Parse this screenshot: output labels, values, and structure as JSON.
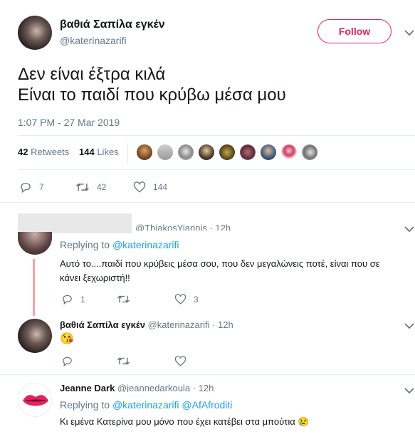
{
  "main_tweet": {
    "display_name": "βαθιά Σαπίλα εγκέν",
    "handle": "@katerinazarifi",
    "follow_label": "Follow",
    "text_line1": "Δεν είναι έξτρα κιλά",
    "text_line2": "Είναι το παιδί που κρύβω μέσα μου",
    "timestamp": "1:07 PM - 27 Mar 2019",
    "retweets_count": "42",
    "retweets_label": "Retweets",
    "likes_count": "144",
    "likes_label": "Likes",
    "reply_count": "7",
    "retweet_action_count": "42",
    "like_action_count": "144"
  },
  "replies": [
    {
      "author_partial": "@ThiakosYiannis · 12h",
      "replying_label": "Replying to",
      "replying_to": "@katerinazarifi",
      "text_line1": "Αυτό το....παιδί που κρύβεις μέσα σου, που δεν μεγαλώνεις ποτέ, είναι που σε",
      "text_line2": "κάνει ξεχωριστή!!",
      "reply_count": "1",
      "retweet_count": "",
      "like_count": "3"
    },
    {
      "display_name": "βαθιά Σαπίλα εγκέν",
      "handle_time": "@katerinazarifi · 12h",
      "emoji": "😘",
      "reply_count": "",
      "retweet_count": "",
      "like_count": ""
    },
    {
      "display_name": "Jeanne Dark",
      "handle_time": "@jeannedarkoula · 12h",
      "replying_label": "Replying to",
      "replying_to_1": "@katerinazarifi",
      "replying_to_2": "@AfAfroditi",
      "text": "Κι εμένα Κατερίνα μου μόνο που έχει κατέβει στα μπούτια",
      "emoji": "😢"
    }
  ],
  "colors": {
    "accent": "#1da1f2",
    "follow": "#e0245e",
    "muted": "#657786",
    "thread_line": "#f4a3a8"
  },
  "icons": [
    "reply-icon",
    "retweet-icon",
    "heart-icon",
    "chevron-down-icon"
  ]
}
